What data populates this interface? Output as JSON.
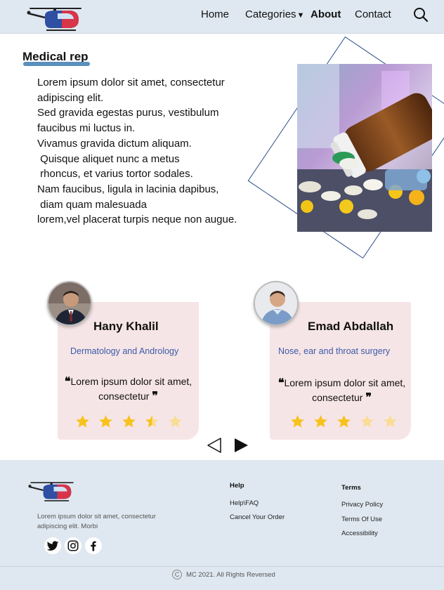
{
  "nav": {
    "logo_icon": "helicopter-logo",
    "items": [
      {
        "label": "Home"
      },
      {
        "label": "Categories"
      },
      {
        "label": "About"
      },
      {
        "label": "Contact"
      }
    ],
    "active": "About",
    "search_icon": "search-icon"
  },
  "about": {
    "title": "Medical rep",
    "text": "Lorem ipsum dolor sit amet, consectetur\nadipiscing elit.\nSed gravida egestas purus, vestibulum\nfaucibus mi luctus in.\nVivamus gravida dictum aliquam.\n Quisque aliquet nunc a metus\n rhoncus, et varius tortor sodales.\nNam faucibus, ligula in lacinia dapibus,\n diam quam malesuada\nlorem,vel placerat turpis neque non augue.",
    "image_icon": "medicine-pills-photo"
  },
  "reviews": [
    {
      "name": "Hany Khalil",
      "specialty": "Dermatology and Andrology",
      "quote": "Lorem ipsum dolor sit amet, consectetur",
      "rating": 3.5,
      "max_rating": 5
    },
    {
      "name": "Emad Abdallah",
      "specialty": "Nose, ear and throat surgery",
      "quote": "Lorem ipsum dolor sit amet, consectetur",
      "rating": 3,
      "max_rating": 5
    }
  ],
  "carousel": {
    "prev_icon": "triangle-left-icon",
    "next_icon": "triangle-right-icon"
  },
  "footer": {
    "description": "Lorem ipsum dolor sit amet, consectetur adipiscing elit. Morbi",
    "social_icons": [
      "twitter-icon",
      "instagram-icon",
      "facebook-icon"
    ],
    "help": {
      "heading": "Help",
      "links": [
        "Help\\FAQ",
        "Cancel Your Order"
      ]
    },
    "terms": {
      "heading": "Terms",
      "links": [
        "Privacy Policy",
        "Terms Of Use",
        "Accessibility"
      ]
    },
    "copyright_symbol": "C",
    "copyright": "MC 2021. All Rights Reversed"
  },
  "colors": {
    "nav_bg": "#dfe8f0",
    "accent_underline": "#5b8fbd",
    "specialty_text": "#3b5aa8",
    "card_bg": "#f6e5e6",
    "star": "#f7c21a",
    "star_faded": "#f9dc95"
  }
}
